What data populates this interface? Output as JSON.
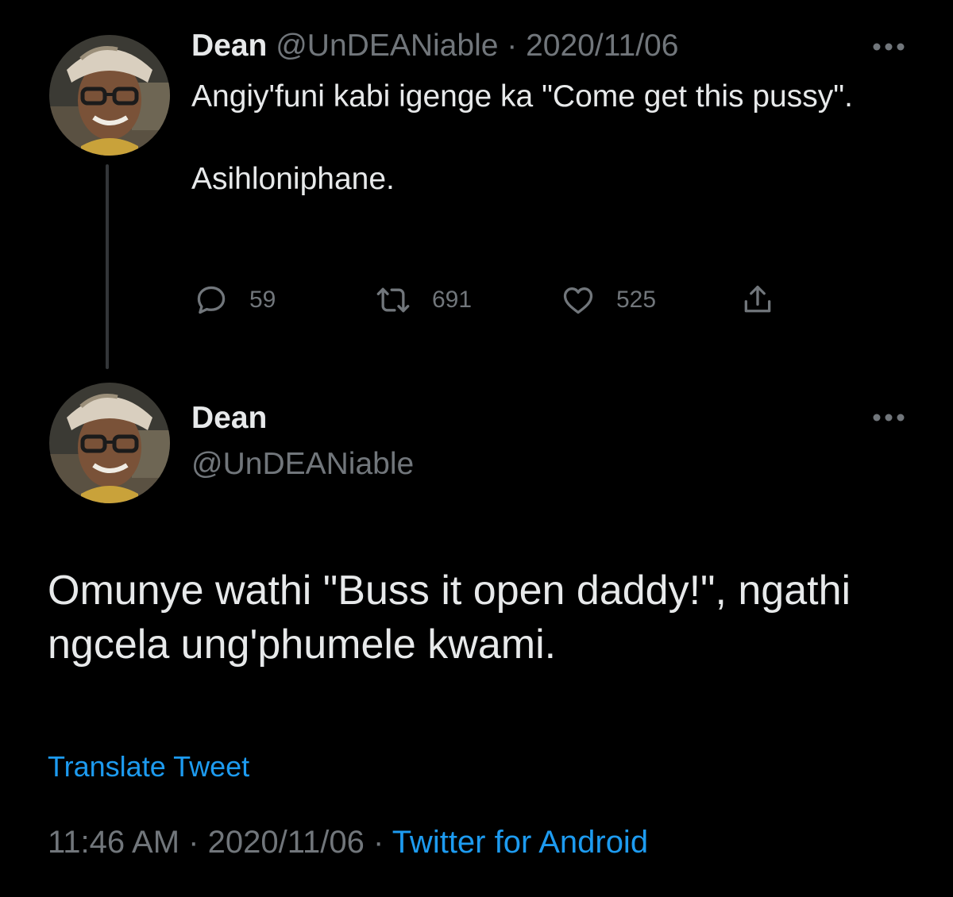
{
  "colors": {
    "background": "#000000",
    "text": "#e7e9ea",
    "muted": "#71767b",
    "link": "#1d9bf0",
    "thread_line": "#333639"
  },
  "parent_tweet": {
    "name": "Dean",
    "handle": "@UnDEANiable",
    "separator": "·",
    "date": "2020/11/06",
    "text_lines": [
      "Angiy'funi kabi igenge ka \"Come get this pussy\".",
      "Asihloniphane."
    ],
    "more_icon": "more-horizontal-icon",
    "actions": {
      "replies": {
        "icon": "reply-icon",
        "count": "59"
      },
      "retweets": {
        "icon": "retweet-icon",
        "count": "691"
      },
      "likes": {
        "icon": "heart-icon",
        "count": "525"
      },
      "share": {
        "icon": "share-icon"
      }
    }
  },
  "main_tweet": {
    "name": "Dean",
    "handle": "@UnDEANiable",
    "more_icon": "more-horizontal-icon",
    "text": "Omunye wathi \"Buss it open daddy!\", ngathi ngcela ung'phumele kwami.",
    "translate_label": "Translate Tweet",
    "time": "11:46 AM",
    "separator": "·",
    "date": "2020/11/06",
    "source": "Twitter for Android"
  }
}
